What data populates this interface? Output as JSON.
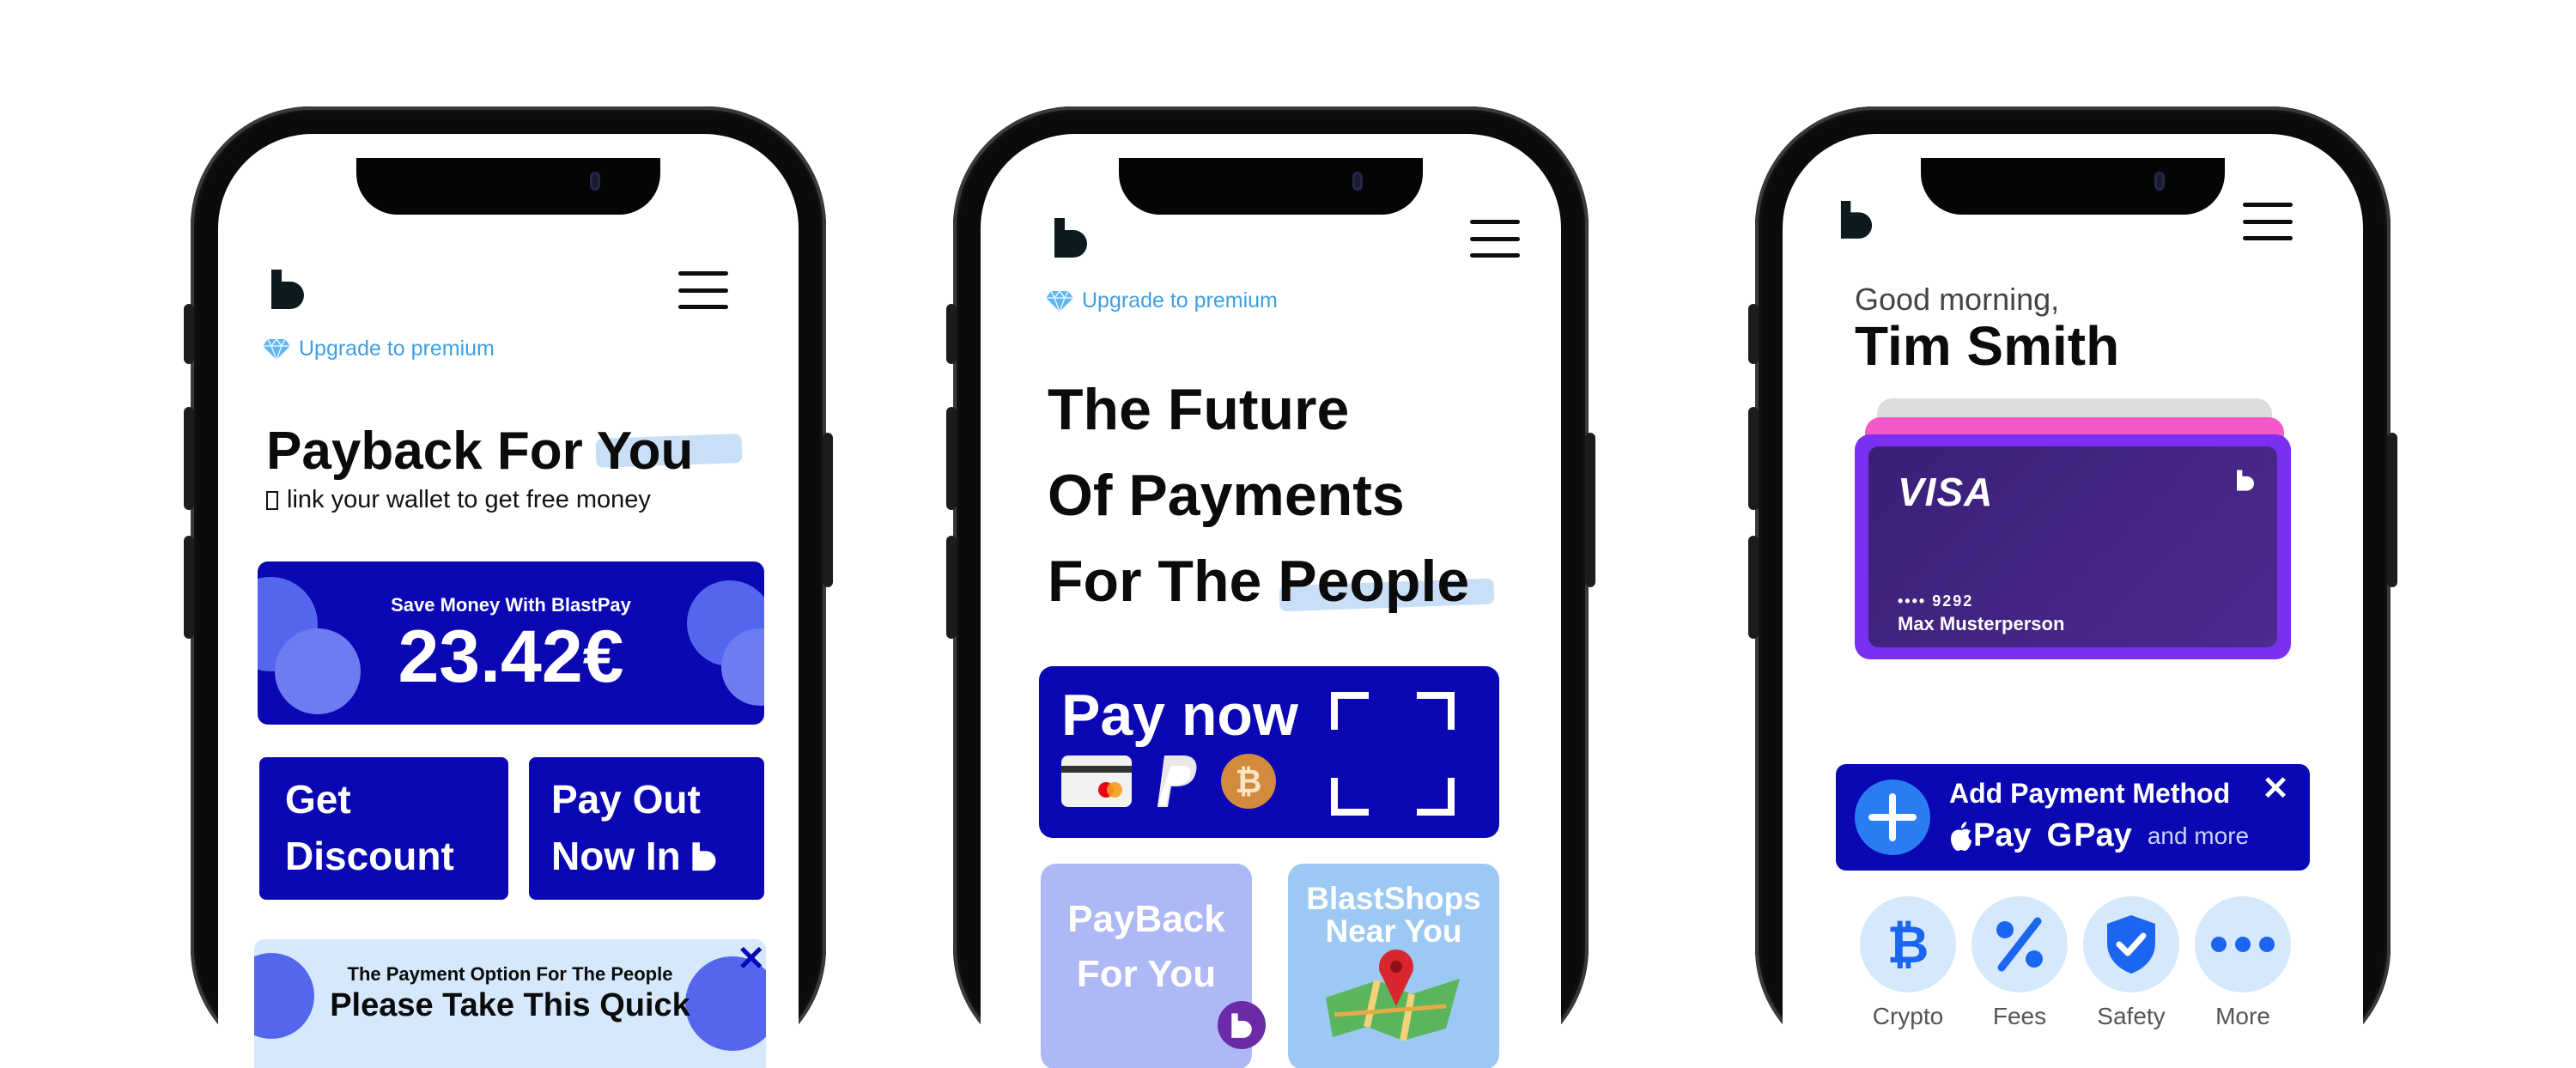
{
  "colors": {
    "primary_blue": "#0a07b3",
    "accent_light_blue": "#3f9fe0",
    "card_purple": "#3d1f7a",
    "highlight": "#c8dff7"
  },
  "phone1": {
    "upgrade_label": "Upgrade to premium",
    "headline": "Payback For You",
    "subtitle_icon": "placeholder-glyph",
    "subtitle": "link your wallet to get free money",
    "savings": {
      "title": "Save Money With BlastPay",
      "amount": "23.42€"
    },
    "get_discount": "Get Discount",
    "get_discount_line1": "Get",
    "get_discount_line2": "Discount",
    "payout_line1": "Pay Out",
    "payout_line2": "Now In",
    "survey": {
      "title": "The Payment Option For The People",
      "text": "Please Take This Quick"
    }
  },
  "phone2": {
    "upgrade_label": "Upgrade to premium",
    "headline_line1": "The Future",
    "headline_line2": "Of Payments",
    "headline_line3_a": "For The ",
    "headline_line3_b": "People",
    "pay_now": "Pay now",
    "payback_line1": "PayBack",
    "payback_line2": "For You",
    "shops_line1": "BlastShops",
    "shops_line2": "Near You"
  },
  "phone3": {
    "greeting": "Good morning,",
    "name": "Tim Smith",
    "card": {
      "brand": "VISA",
      "number": "•••• 9292",
      "holder": "Max Musterperson"
    },
    "add_payment": {
      "title": "Add Payment Method",
      "apple_pay": "Pay",
      "google_pay": "Pay",
      "more": "and more"
    },
    "quick_actions": [
      {
        "label": "Crypto",
        "icon": "bitcoin-icon"
      },
      {
        "label": "Fees",
        "icon": "percent-icon"
      },
      {
        "label": "Safety",
        "icon": "shield-check-icon"
      },
      {
        "label": "More",
        "icon": "more-dots-icon"
      }
    ]
  }
}
